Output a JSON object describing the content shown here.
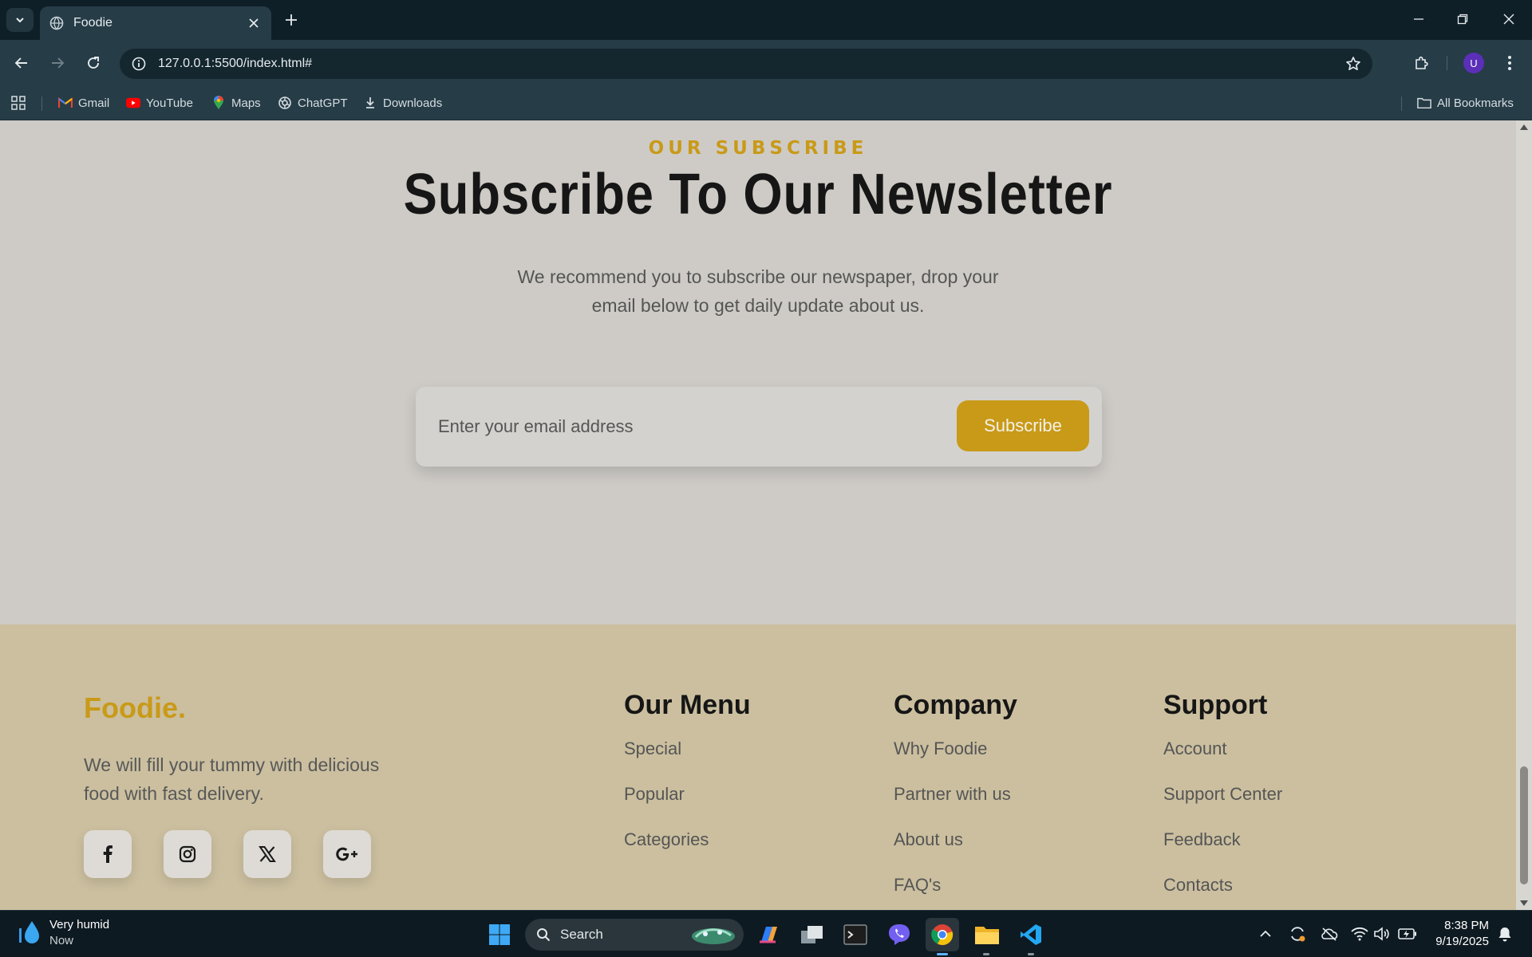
{
  "browser": {
    "tab_title": "Foodie",
    "url": "127.0.0.1:5500/index.html#",
    "avatar_initial": "U",
    "bookmarks": [
      {
        "label": "Gmail",
        "icon": "gmail-icon"
      },
      {
        "label": "YouTube",
        "icon": "youtube-icon"
      },
      {
        "label": "Maps",
        "icon": "maps-icon"
      },
      {
        "label": "ChatGPT",
        "icon": "chatgpt-icon"
      },
      {
        "label": "Downloads",
        "icon": "download-icon"
      }
    ],
    "all_bookmarks": "All Bookmarks"
  },
  "subscribe": {
    "eyebrow": "OUR SUBSCRIBE",
    "title": "Subscribe To Our Newsletter",
    "description": "We recommend you to subscribe our newspaper, drop your email below to get daily update about us.",
    "email_placeholder": "Enter your email address",
    "button_label": "Subscribe"
  },
  "footer": {
    "brand": "Foodie.",
    "tagline": "We will fill your tummy with delicious food with fast delivery.",
    "socials": [
      {
        "label": "f",
        "icon": "facebook-icon"
      },
      {
        "label": "◎",
        "icon": "instagram-icon"
      },
      {
        "label": "X",
        "icon": "x-twitter-icon"
      },
      {
        "label": "G+",
        "icon": "google-plus-icon"
      }
    ],
    "columns": [
      {
        "title": "Our Menu",
        "links": [
          "Special",
          "Popular",
          "Categories"
        ]
      },
      {
        "title": "Company",
        "links": [
          "Why Foodie",
          "Partner with us",
          "About us",
          "FAQ's"
        ]
      },
      {
        "title": "Support",
        "links": [
          "Account",
          "Support Center",
          "Feedback",
          "Contacts"
        ]
      }
    ]
  },
  "taskbar": {
    "weather_title": "Very humid",
    "weather_sub": "Now",
    "search_label": "Search",
    "time": "8:38 PM",
    "date": "9/19/2025"
  },
  "colors": {
    "accent": "#c99a18",
    "subscribe_bg": "#cecbc6",
    "footer_bg": "#cbbf9f",
    "browser_dark": "#0f1f27",
    "toolbar": "#263c47"
  }
}
